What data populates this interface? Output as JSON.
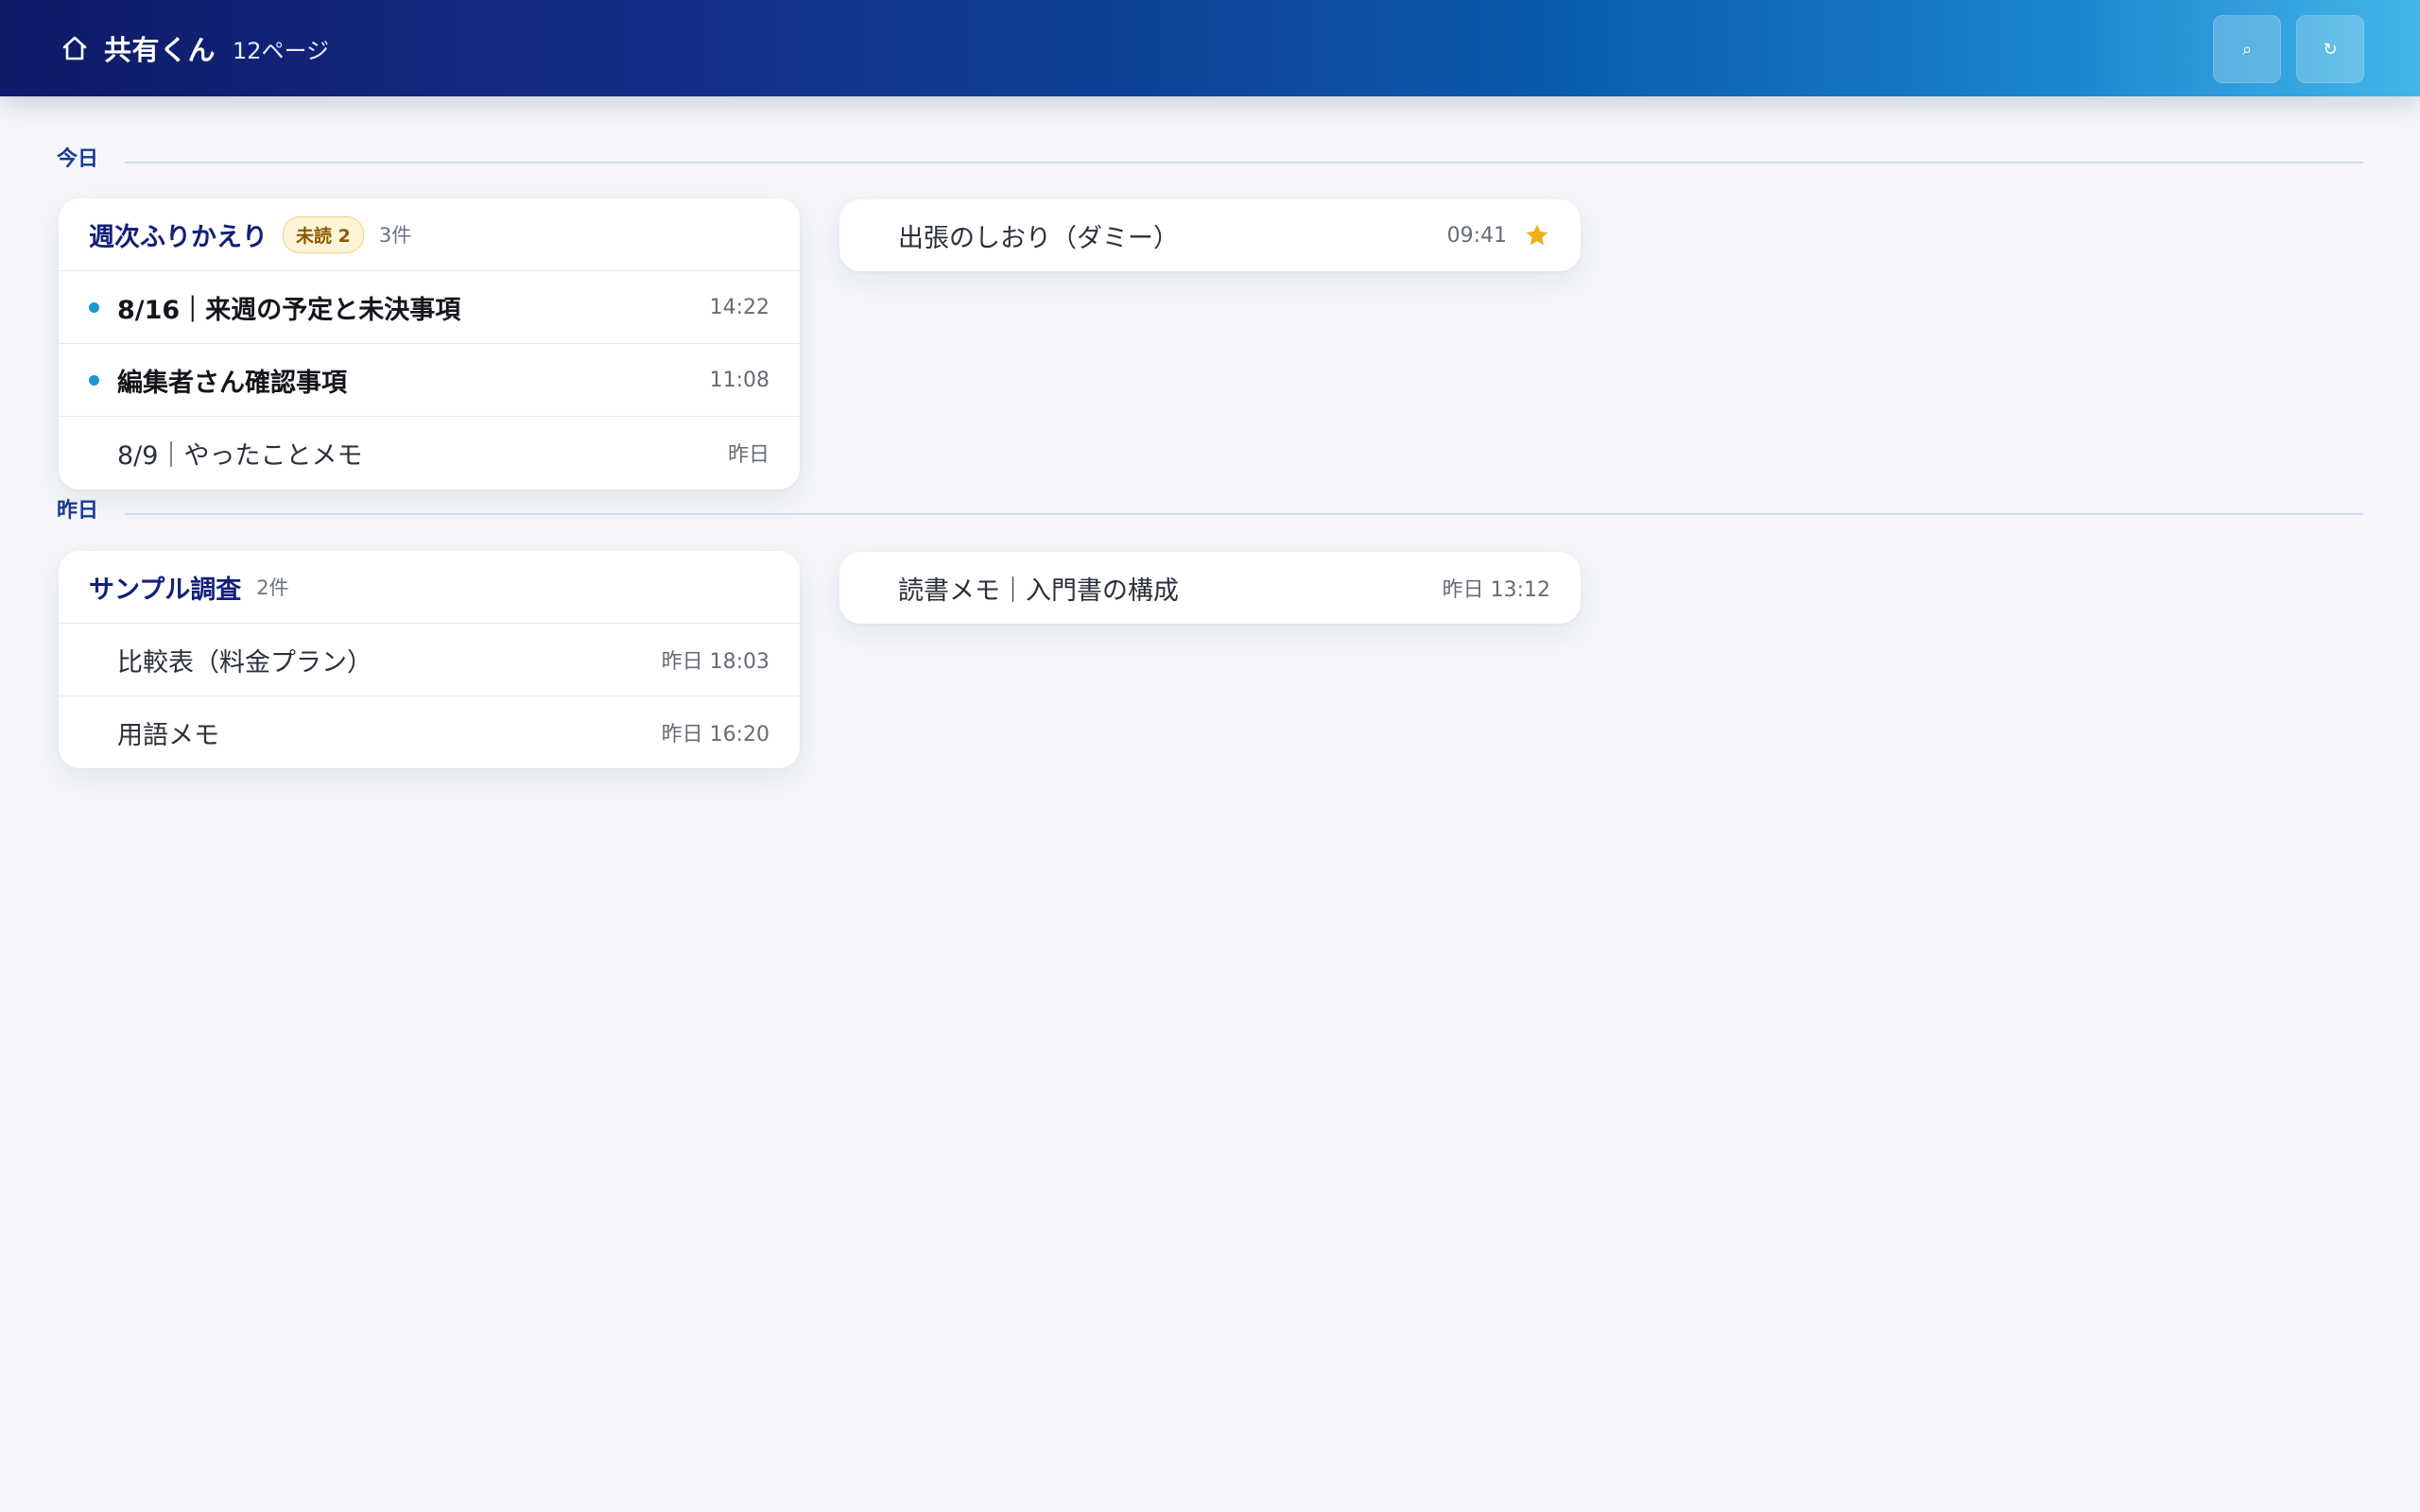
{
  "header": {
    "home_icon": "home-icon",
    "title": "共有くん",
    "page_count": "12ページ",
    "search_button_glyph": "⌕",
    "refresh_button_glyph": "↻"
  },
  "sections": [
    {
      "label": "今日",
      "groups": [
        {
          "title": "週次ふりかえり",
          "badge": "未読 2",
          "count": "3件",
          "items": [
            {
              "title": "8/16｜来週の予定と未決事項",
              "time": "14:22",
              "unread": true
            },
            {
              "title": "編集者さん確認事項",
              "time": "11:08",
              "unread": true
            },
            {
              "title": "8/9｜やったことメモ",
              "time": "昨日",
              "unread": false
            }
          ]
        }
      ],
      "singles": [
        {
          "title": "出張のしおり（ダミー）",
          "time": "09:41",
          "starred": true
        }
      ]
    },
    {
      "label": "昨日",
      "groups": [
        {
          "title": "サンプル調査",
          "count": "2件",
          "items": [
            {
              "title": "比較表（料金プラン）",
              "time": "昨日 18:03",
              "unread": false
            },
            {
              "title": "用語メモ",
              "time": "昨日 16:20",
              "unread": false
            }
          ]
        }
      ],
      "singles": [
        {
          "title": "読書メモ｜入門書の構成",
          "time": "昨日 13:12",
          "starred": false
        }
      ]
    }
  ],
  "colors": {
    "header_start": "#0e1a68",
    "header_end": "#43b6e8",
    "group_title": "#13207a",
    "section_label": "#1a3a8f",
    "unread_dot": "#1a97d8",
    "star": "#f0ad1c",
    "badge_bg": "#fff4d6",
    "badge_text": "#8a5a00"
  }
}
